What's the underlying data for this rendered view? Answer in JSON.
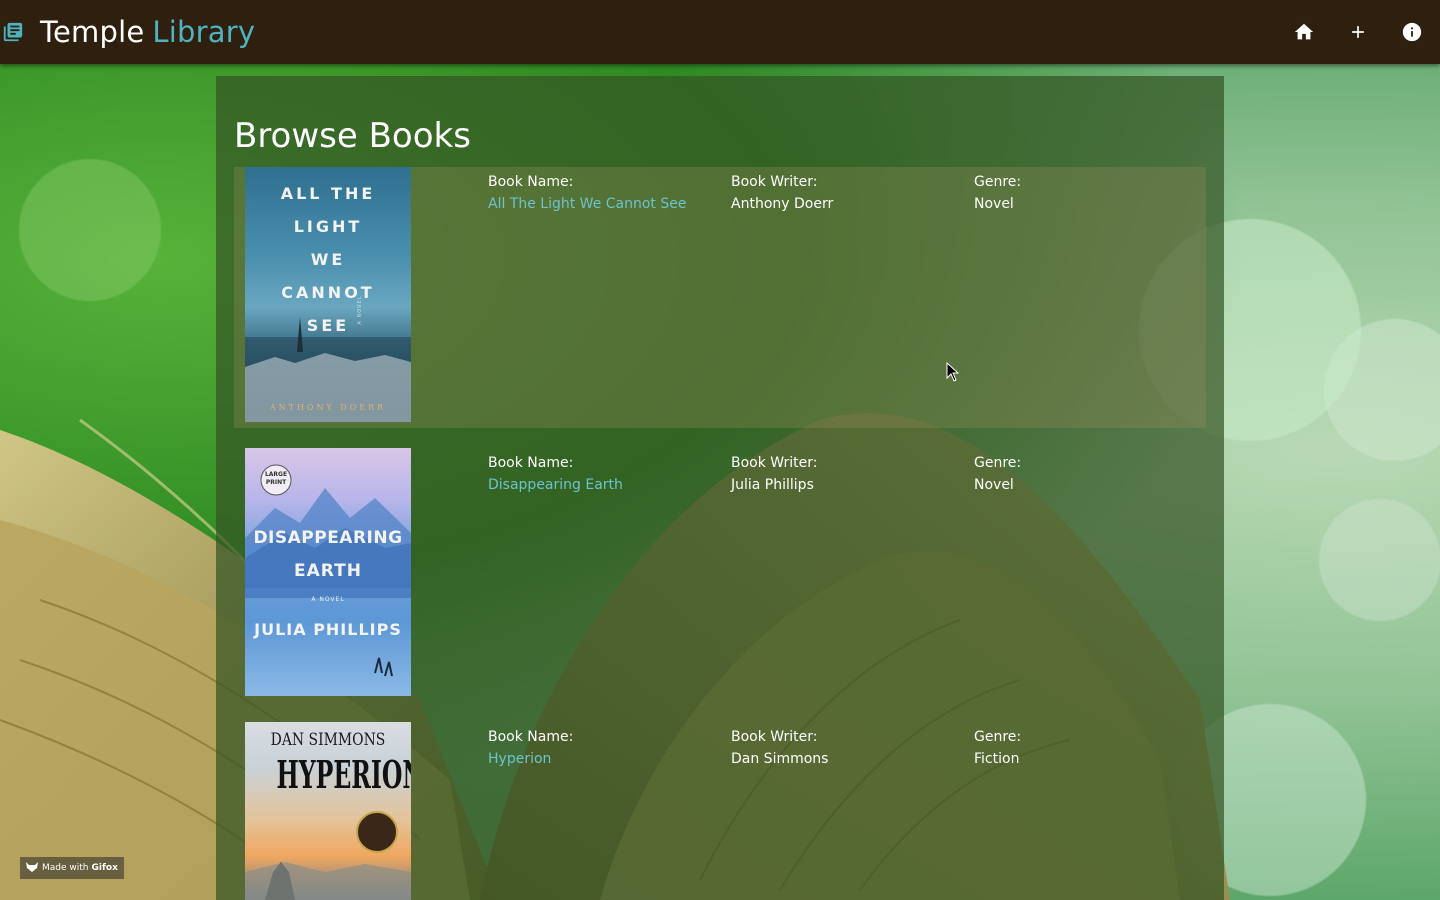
{
  "app": {
    "title_main": "Temple",
    "title_accent": "Library"
  },
  "nav": {
    "home_icon": "home-icon",
    "add_icon": "plus-icon",
    "info_icon": "info-icon"
  },
  "page": {
    "heading": "Browse Books"
  },
  "labels": {
    "name": "Book Name:",
    "writer": "Book Writer:",
    "genre": "Genre:"
  },
  "books": [
    {
      "name": "All The Light We Cannot See",
      "writer": "Anthony Doerr",
      "genre": "Novel",
      "cover_lines": [
        "ALL THE",
        "LIGHT",
        "WE",
        "CANNOT",
        "SEE"
      ],
      "cover_author": "ANTHONY DOERR",
      "cover_tag": "A NOVEL"
    },
    {
      "name": "Disappearing Earth",
      "writer": "Julia Phillips",
      "genre": "Novel",
      "cover_badge": "LARGE PRINT",
      "cover_lines": [
        "DISAPPEARING",
        "EARTH"
      ],
      "cover_tag": "A NOVEL",
      "cover_author": "JULIA PHILLIPS"
    },
    {
      "name": "Hyperion",
      "writer": "Dan Simmons",
      "genre": "Fiction",
      "cover_author": "DAN SIMMONS",
      "cover_lines": [
        "HYPERION"
      ]
    }
  ],
  "watermark": {
    "prefix": "Made with",
    "brand": "Gifox"
  },
  "colors": {
    "topbar": "#2f1f0e",
    "accent": "#4fb3bf",
    "link": "#6fc2c9"
  }
}
